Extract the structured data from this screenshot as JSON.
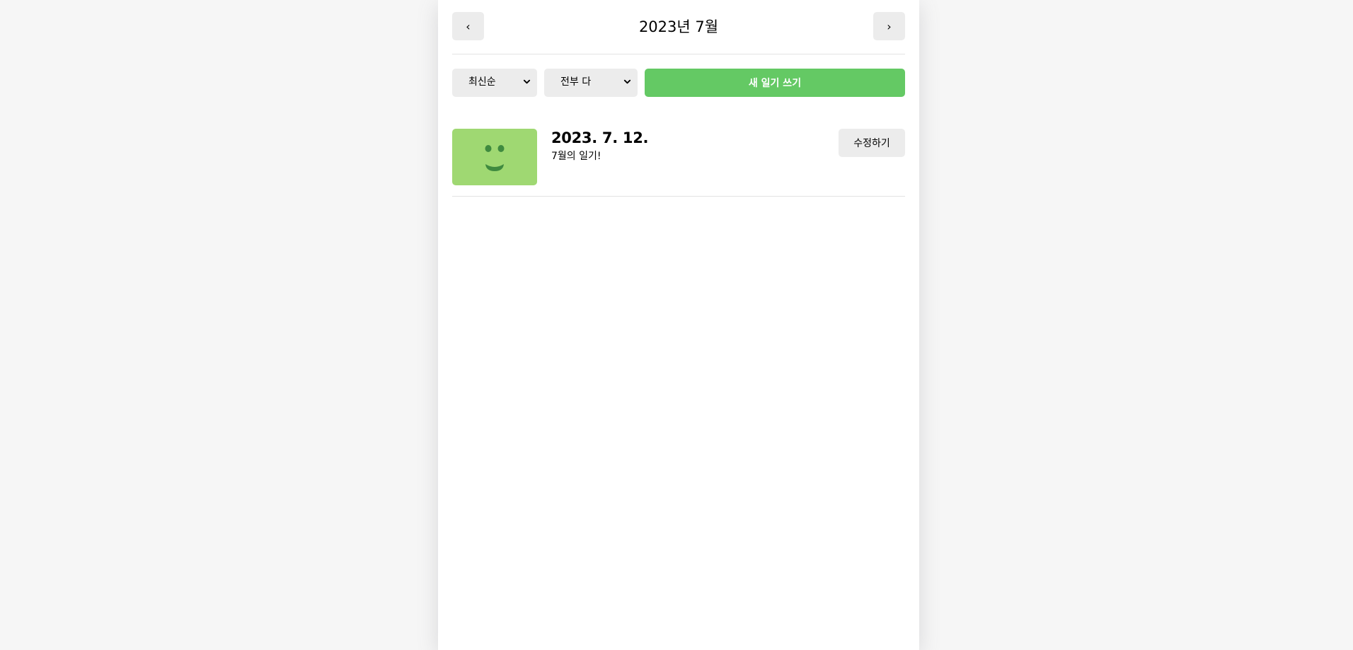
{
  "header": {
    "title": "2023년 7월",
    "prev_label": "‹",
    "next_label": "›"
  },
  "menu": {
    "sort_selected": "최신순",
    "filter_selected": "전부 다",
    "new_button_label": "새 일기 쓰기"
  },
  "diaries": [
    {
      "date": "2023. 7. 12.",
      "content": "7월의 일기!",
      "emotion_icon": "smile-emotion-icon",
      "emotion_color": "#9fd872",
      "edit_label": "수정하기"
    }
  ],
  "colors": {
    "accent": "#64c964",
    "button_bg": "#ececec",
    "page_bg": "#f6f6f6"
  }
}
